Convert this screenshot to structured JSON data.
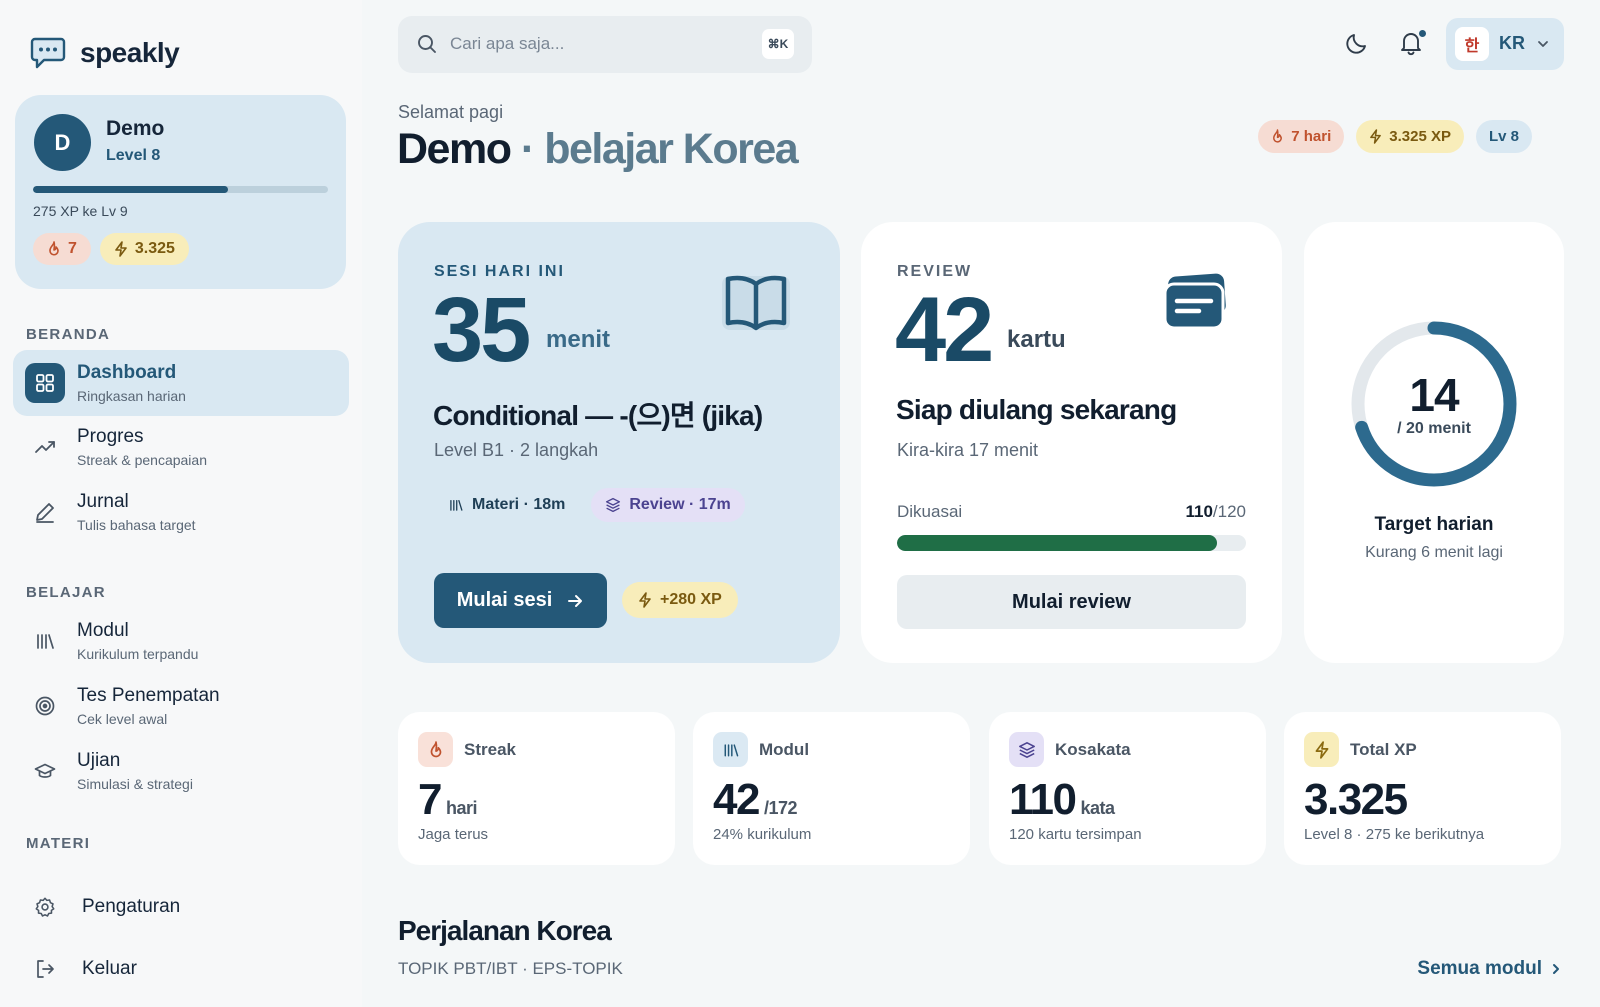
{
  "app": {
    "name": "speakly"
  },
  "profile": {
    "initial": "D",
    "name": "Demo",
    "level": "Level 8",
    "level_progress": 0.66,
    "xp_to_next": "275 XP ke Lv 9",
    "streak": "7",
    "xp": "3.325"
  },
  "sidebar": {
    "sections": [
      {
        "label": "BERANDA"
      },
      {
        "label": "BELAJAR"
      },
      {
        "label": "MATERI"
      }
    ],
    "items": [
      {
        "title": "Dashboard",
        "sub": "Ringkasan harian",
        "icon": "grid-icon",
        "active": true
      },
      {
        "title": "Progres",
        "sub": "Streak & pencapaian",
        "icon": "trending-up-icon"
      },
      {
        "title": "Jurnal",
        "sub": "Tulis bahasa target",
        "icon": "pencil-icon"
      },
      {
        "title": "Modul",
        "sub": "Kurikulum terpandu",
        "icon": "library-icon"
      },
      {
        "title": "Tes Penempatan",
        "sub": "Cek level awal",
        "icon": "target-icon"
      },
      {
        "title": "Ujian",
        "sub": "Simulasi & strategi",
        "icon": "graduation-cap-icon"
      }
    ],
    "footer": [
      {
        "title": "Pengaturan",
        "icon": "gear-icon"
      },
      {
        "title": "Keluar",
        "icon": "logout-icon"
      }
    ]
  },
  "header": {
    "search_placeholder": "Cari apa saja...",
    "search_shortcut": "⌘K",
    "language_flag": "한",
    "language_code": "KR"
  },
  "hero": {
    "greeting": "Selamat pagi",
    "name": "Demo",
    "separator": "·",
    "subtitle": "belajar Korea",
    "badges": {
      "streak": "7 hari",
      "xp": "3.325 XP",
      "level": "Lv 8"
    }
  },
  "today": {
    "label": "SESI HARI INI",
    "value": "35",
    "unit": "menit",
    "title": "Conditional — -(으)면 (jika)",
    "sub": "Level B1 · 2 langkah",
    "chip_material": "Materi · 18m",
    "chip_review": "Review · 17m",
    "button": "Mulai sesi",
    "xp_reward": "+280 XP"
  },
  "review": {
    "label": "REVIEW",
    "value": "42",
    "unit": "kartu",
    "title": "Siap diulang sekarang",
    "sub": "Kira-kira 17 menit",
    "mastered_label": "Dikuasai",
    "mastered_count": "110",
    "mastered_total": "/120",
    "mastered_fraction": 0.917,
    "button": "Mulai review"
  },
  "target": {
    "value": "14",
    "sub": "/ 20 menit",
    "fraction": 0.7,
    "title": "Target harian",
    "note": "Kurang 6 menit lagi"
  },
  "stats": [
    {
      "label": "Streak",
      "value": "7",
      "unit": "hari",
      "sub": "Jaga terus",
      "icon": "flame-icon",
      "bg": "#f9e1d9",
      "color": "#c0522e"
    },
    {
      "label": "Modul",
      "value": "42",
      "unit": "/172",
      "sub": "24% kurikulum",
      "icon": "library-icon",
      "bg": "#dbe9f3",
      "color": "#245878"
    },
    {
      "label": "Kosakata",
      "value": "110",
      "unit": "kata",
      "sub": "120 kartu tersimpan",
      "icon": "layers-icon",
      "bg": "#e4e0f6",
      "color": "#4b4390"
    },
    {
      "label": "Total XP",
      "value": "3.325",
      "unit": "",
      "sub": "Level 8 · 275 ke berikutnya",
      "icon": "bolt-icon",
      "bg": "#f8edba",
      "color": "#8a6a10"
    }
  ],
  "journey": {
    "title": "Perjalanan Korea",
    "sub": "TOPIK PBT/IBT · EPS-TOPIK",
    "link": "Semua modul"
  },
  "colors": {
    "primary": "#245878",
    "accent_green": "#1f6e46",
    "panel": "#d9e8f2"
  }
}
